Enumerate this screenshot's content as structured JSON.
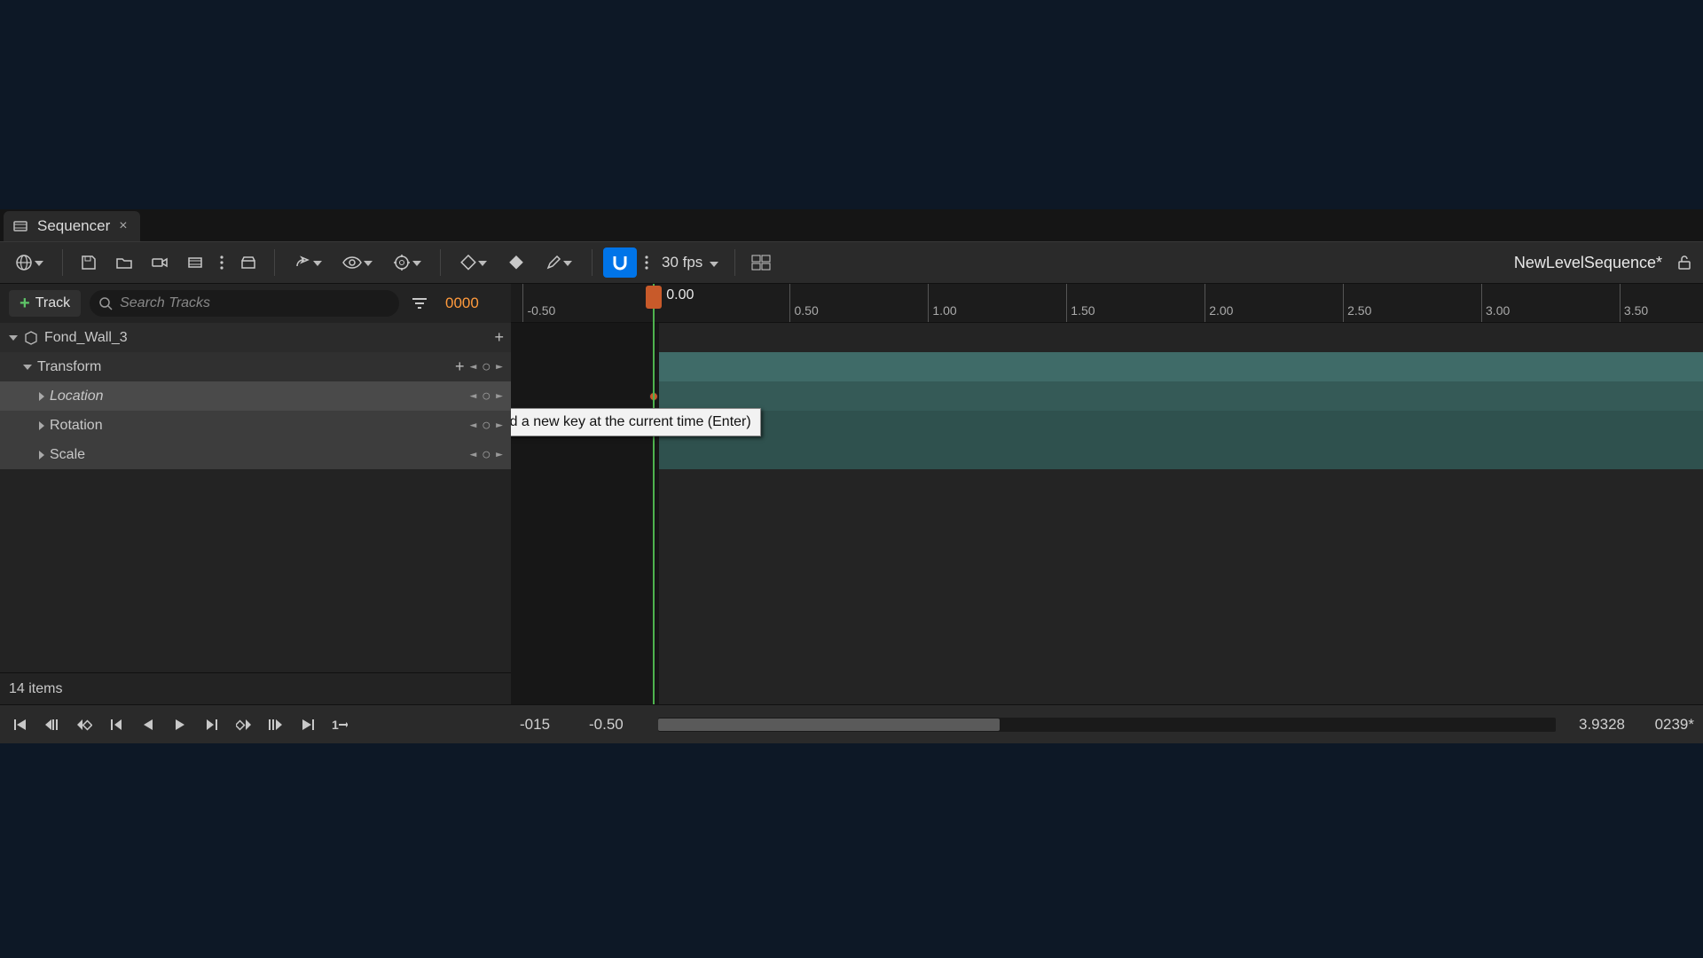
{
  "tab": {
    "title": "Sequencer",
    "icon": "sequencer-icon"
  },
  "toolbar": {
    "fps_label": "30 fps",
    "sequence_name": "NewLevelSequence*"
  },
  "track_header": {
    "add_track_label": "Track",
    "search_placeholder": "Search Tracks",
    "current_frame": "0000"
  },
  "tree": {
    "object": {
      "name": "Fond_Wall_3"
    },
    "transform_label": "Transform",
    "props": [
      {
        "name": "Location",
        "selected": true
      },
      {
        "name": "Rotation",
        "selected": false
      },
      {
        "name": "Scale",
        "selected": false
      }
    ]
  },
  "footer": {
    "item_count": "14 items"
  },
  "ruler": {
    "playhead_time_label": "0.00",
    "ticks": [
      {
        "label": "-0.50",
        "pos_pct": 1.0
      },
      {
        "label": "0.50",
        "pos_pct": 23.4
      },
      {
        "label": "1.00",
        "pos_pct": 35.0
      },
      {
        "label": "1.50",
        "pos_pct": 46.6
      },
      {
        "label": "2.00",
        "pos_pct": 58.2
      },
      {
        "label": "2.50",
        "pos_pct": 69.8
      },
      {
        "label": "3.00",
        "pos_pct": 81.4
      },
      {
        "label": "3.50",
        "pos_pct": 93.0
      }
    ],
    "playhead_pos_pct": 12.0,
    "start_boundary_pct": 12.4
  },
  "ranges": {
    "in_frame": "-015",
    "in_time": "-0.50",
    "out_time": "3.9328",
    "out_frame": "0239*"
  },
  "tooltip": {
    "text": "Add a new key at the current time (Enter)"
  }
}
